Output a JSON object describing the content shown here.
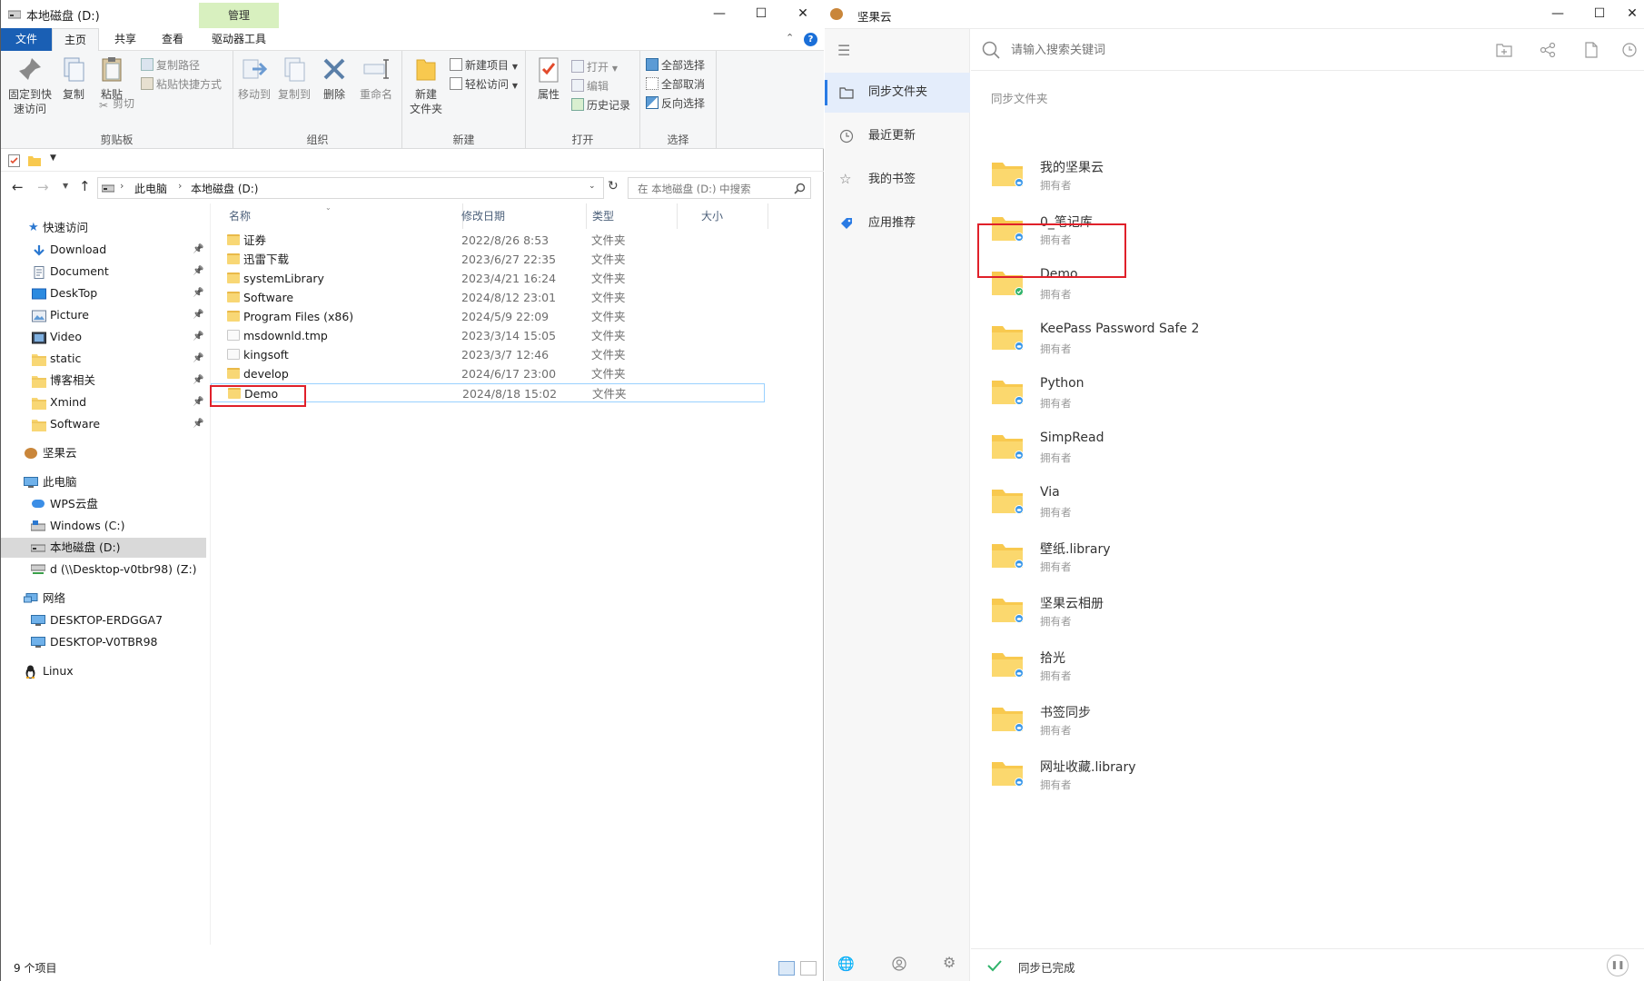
{
  "explorer": {
    "title": "本地磁盘 (D:)",
    "manage_tab": "管理",
    "menu": {
      "file": "文件",
      "home": "主页",
      "share": "共享",
      "view": "查看",
      "drive_tools": "驱动器工具"
    },
    "ribbon": {
      "pin": [
        "固定到快",
        "速访问"
      ],
      "copy": "复制",
      "paste": "粘贴",
      "copy_path": "复制路径",
      "paste_shortcut": "粘贴快捷方式",
      "cut": "剪切",
      "clipboard": "剪贴板",
      "move_to": "移动到",
      "copy_to": "复制到",
      "delete": "删除",
      "rename": "重命名",
      "organize": "组织",
      "new_folder": [
        "新建",
        "文件夹"
      ],
      "new_item": "新建项目",
      "easy_access": "轻松访问",
      "new": "新建",
      "properties": "属性",
      "open": "打开",
      "edit": "编辑",
      "history": "历史记录",
      "open_group": "打开",
      "select_all": "全部选择",
      "select_none": "全部取消",
      "invert_select": "反向选择",
      "select_group": "选择"
    },
    "address": {
      "this_pc": "此电脑",
      "drive": "本地磁盘 (D:)"
    },
    "search_placeholder": "在 本地磁盘 (D:) 中搜索",
    "nav": {
      "quick_access": "快速访问",
      "pinned": [
        "Download",
        "Document",
        "DeskTop",
        "Picture",
        "Video",
        "static",
        "博客相关",
        "Xmind",
        "Software"
      ],
      "jianguoyun": "坚果云",
      "this_pc": "此电脑",
      "pc_items": [
        "WPS云盘",
        "Windows (C:)",
        "本地磁盘 (D:)",
        "d (\\\\Desktop-v0tbr98) (Z:)"
      ],
      "network": "网络",
      "network_items": [
        "DESKTOP-ERDGGA7",
        "DESKTOP-V0TBR98"
      ],
      "linux": "Linux"
    },
    "columns": {
      "name": "名称",
      "modified": "修改日期",
      "type": "类型",
      "size": "大小"
    },
    "files": [
      {
        "name": "证券",
        "date": "2022/8/26 8:53",
        "type": "文件夹"
      },
      {
        "name": "迅雷下载",
        "date": "2023/6/27 22:35",
        "type": "文件夹"
      },
      {
        "name": "systemLibrary",
        "date": "2023/4/21 16:24",
        "type": "文件夹"
      },
      {
        "name": "Software",
        "date": "2024/8/12 23:01",
        "type": "文件夹"
      },
      {
        "name": "Program Files (x86)",
        "date": "2024/5/9 22:09",
        "type": "文件夹"
      },
      {
        "name": "msdownld.tmp",
        "date": "2023/3/14 15:05",
        "type": "文件夹"
      },
      {
        "name": "kingsoft",
        "date": "2023/3/7 12:46",
        "type": "文件夹"
      },
      {
        "name": "develop",
        "date": "2024/6/17 23:00",
        "type": "文件夹"
      },
      {
        "name": "Demo",
        "date": "2024/8/18 15:02",
        "type": "文件夹"
      }
    ],
    "status": "9 个项目"
  },
  "nutstore": {
    "title": "坚果云",
    "search_placeholder": "请输入搜索关键词",
    "nav": [
      "同步文件夹",
      "最近更新",
      "我的书签",
      "应用推荐"
    ],
    "section_title": "同步文件夹",
    "owner_label": "拥有者",
    "folders": [
      "我的坚果云",
      "0_笔记库",
      "Demo",
      "KeePass Password Safe 2",
      "Python",
      "SimpRead",
      "Via",
      "壁纸.library",
      "坚果云相册",
      "拾光",
      "书签同步",
      "网址收藏.library"
    ],
    "status": "同步已完成",
    "colors": {
      "accent": "#2a7be4",
      "synced": "#2fb36a",
      "folder": "#f8c94f"
    }
  }
}
